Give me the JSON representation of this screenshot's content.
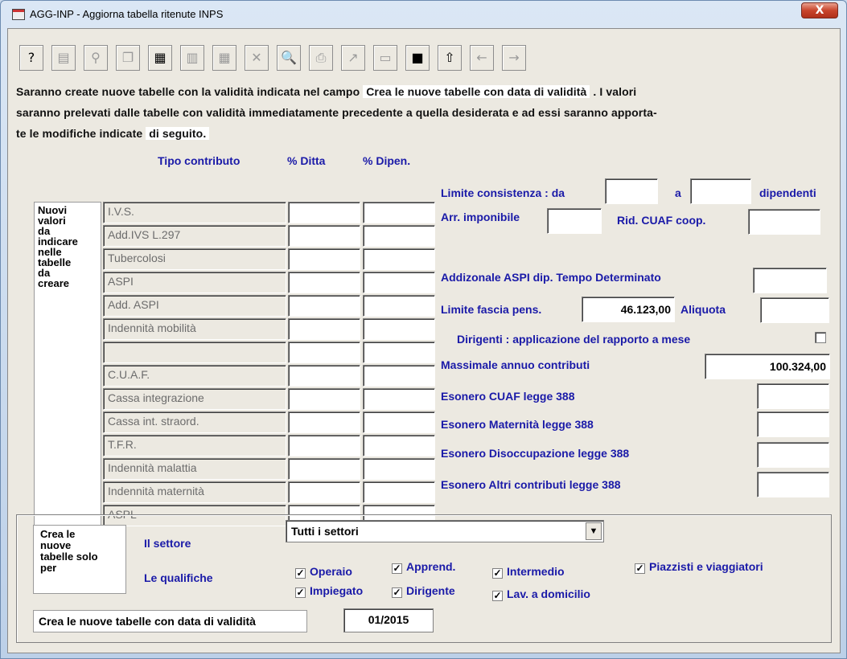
{
  "window": {
    "title": "AGG-INP - Aggiorna tabella ritenute INPS",
    "close_glyph": "X"
  },
  "toolbar": {
    "buttons": [
      {
        "name": "help-icon",
        "glyph": "?",
        "enabled": true
      },
      {
        "name": "properties-icon",
        "glyph": "▤",
        "enabled": false
      },
      {
        "name": "search-binoculars-icon",
        "glyph": "⚲",
        "enabled": false
      },
      {
        "name": "copy-icon",
        "glyph": "❐",
        "enabled": false
      },
      {
        "name": "calculator-icon",
        "glyph": "▦",
        "enabled": true
      },
      {
        "name": "paste-icon",
        "glyph": "▥",
        "enabled": false
      },
      {
        "name": "grid-icon",
        "glyph": "▦",
        "enabled": false
      },
      {
        "name": "delete-icon",
        "glyph": "✕",
        "enabled": false
      },
      {
        "name": "preview-icon",
        "glyph": "🔍",
        "enabled": false
      },
      {
        "name": "print-icon",
        "glyph": "⎙",
        "enabled": false
      },
      {
        "name": "export-icon",
        "glyph": "↗",
        "enabled": false
      },
      {
        "name": "form-icon",
        "glyph": "▭",
        "enabled": false
      },
      {
        "name": "save-icon",
        "glyph": "■",
        "enabled": true
      },
      {
        "name": "folder-up-icon",
        "glyph": "⇧",
        "enabled": true
      },
      {
        "name": "arrow-left-icon",
        "glyph": "←",
        "enabled": false
      },
      {
        "name": "arrow-right-icon",
        "glyph": "→",
        "enabled": false
      }
    ]
  },
  "intro": {
    "line1_a": "Saranno create nuove tabelle con la validità indicata nel campo",
    "line1_hl": "Crea le nuove tabelle con data di validità",
    "line1_b": ". I valori",
    "line2": "saranno prelevati dalle tabelle con validità immediatamente precedente a quella desiderata e ad essi saranno apporta-",
    "line3_a": "te le modifiche indicate",
    "line3_hl": "di seguito."
  },
  "headers": {
    "tipo": "Tipo contributo",
    "ditta": "% Ditta",
    "dipen": "% Dipen."
  },
  "nuovi_label": [
    "Nuovi",
    "valori",
    "da",
    "indicare",
    "nelle",
    "tabelle",
    "da",
    "creare"
  ],
  "contributi": [
    "I.V.S.",
    "Add.IVS L.297",
    "Tubercolosi",
    "ASPI",
    "Add. ASPI",
    "Indennità mobilità",
    "",
    "C.U.A.F.",
    "Cassa integrazione",
    "Cassa int. straord.",
    "T.F.R.",
    "Indennità malattia",
    "Indennità maternità",
    "ASPL"
  ],
  "right": {
    "limite_da": "Limite consistenza : da",
    "limite_a": "a",
    "dipendenti": "dipendenti",
    "arr_imponibile": "Arr. imponibile",
    "rid_cuaf": "Rid. CUAF coop.",
    "add_aspi": "Addizonale ASPI dip. Tempo Determinato",
    "limite_fascia": "Limite fascia pens.",
    "limite_fascia_value": "46.123,00",
    "aliquota": "Aliquota",
    "dirigenti": "Dirigenti : applicazione del rapporto a mese",
    "massimale": "Massimale annuo contributi",
    "massimale_value": "100.324,00",
    "esonero_cuaf": "Esonero CUAF legge 388",
    "esonero_maternita": "Esonero Maternità legge 388",
    "esonero_disocc": "Esonero Disoccupazione legge 388",
    "esonero_altri": "Esonero Altri contributi legge 388"
  },
  "bottom": {
    "crea_label": [
      "Crea le",
      "nuove",
      "tabelle solo",
      "per"
    ],
    "settore_label": "Il settore",
    "settore_value": "Tutti i settori",
    "qualifiche_label": "Le qualifiche",
    "operaio": "Operaio",
    "apprend": "Apprend.",
    "intermedio": "Intermedio",
    "piazzisti": "Piazzisti e viaggiatori",
    "impiegato": "Impiegato",
    "dirigente": "Dirigente",
    "lav_domicilio": "Lav. a domicilio",
    "check_glyph": "✓",
    "date_label": "Crea le nuove tabelle con data di validità",
    "date_value": "01/2015"
  }
}
